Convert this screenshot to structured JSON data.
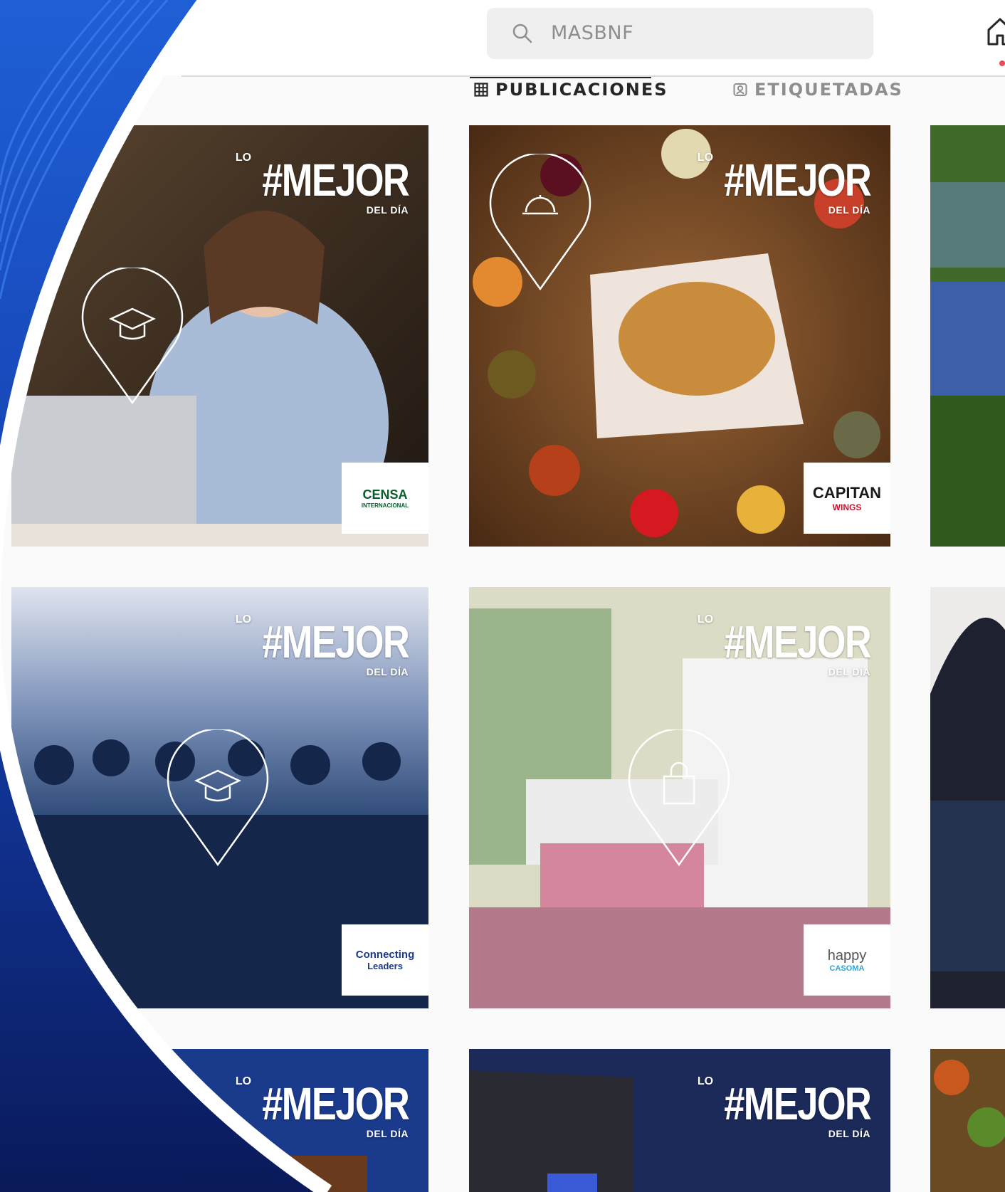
{
  "search": {
    "placeholder": "MASBNF"
  },
  "tabs": [
    {
      "label": "PUBLICACIONES",
      "icon": "grid-icon",
      "active": true
    },
    {
      "label": "ETIQUETADAS",
      "icon": "tagged-icon",
      "active": false
    }
  ],
  "posts": [
    {
      "headline_small": "LO",
      "headline": "#MEJOR",
      "headline_sub": "DEL DÍA",
      "pin_icon": "graduation-cap-icon",
      "logo_text": "CENSA",
      "logo_sub": "INTERNACIONAL"
    },
    {
      "headline_small": "LO",
      "headline": "#MEJOR",
      "headline_sub": "DEL DÍA",
      "pin_icon": "food-cloche-icon",
      "logo_text": "CAPITAN",
      "logo_sub": "WINGS"
    },
    {
      "headline_small": "LO",
      "headline": "#MEJOR",
      "headline_sub": "DEL DÍA",
      "pin_icon": "graduation-cap-icon",
      "logo_text": "Connecting",
      "logo_sub": "Leaders"
    },
    {
      "headline_small": "LO",
      "headline": "#MEJOR",
      "headline_sub": "DEL DÍA",
      "pin_icon": "shopping-bag-icon",
      "logo_text": "happy",
      "logo_sub": "CASOMA"
    },
    {
      "headline_small": "LO",
      "headline": "#MEJOR",
      "headline_sub": "DEL DÍA"
    },
    {
      "headline_small": "LO",
      "headline": "#MEJOR",
      "headline_sub": "DEL DÍA"
    }
  ],
  "colors": {
    "accent_blue": "#0b2a8a",
    "notification": "#ed4956"
  }
}
